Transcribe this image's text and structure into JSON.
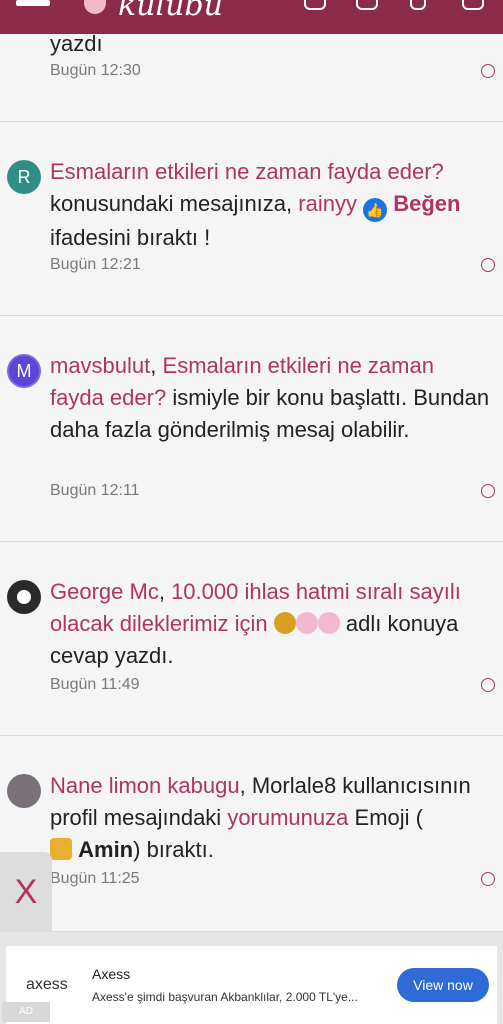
{
  "header": {
    "logo": "kulübü"
  },
  "items": [
    {
      "partial_text": "yazdı",
      "time": "Bugün 12:30"
    },
    {
      "avatar_letter": "R",
      "avatar_color": "#2f8f86",
      "line1_link": "Esmaların etkileri ne zaman fayda eder?",
      "line2_pre": "konusundaki mesajınıza,",
      "line2_user": "rainyy",
      "line2_like": "Beğen",
      "line3": "ifadesini bıraktı !",
      "time": "Bugün 12:21"
    },
    {
      "avatar_letter": "M",
      "avatar_color": "#5b46d6",
      "user": "mavsbulut",
      "link": "Esmaların etkileri ne zaman fayda eder?",
      "text_after": "ismiyle bir konu başlattı.",
      "text_more": "Bundan daha fazla gönderilmiş mesaj olabilir.",
      "time": "Bugün 12:11"
    },
    {
      "user": "George Mc",
      "link": "10.000 ihlas hatmi sıralı sayılı olacak dileklerimiz için",
      "text_after": "adlı konuya cevap yazdı.",
      "time": "Bugün 11:49"
    },
    {
      "user": "Nane limon kabugu",
      "text_mid": "Morlale8 kullanıcısının profil mesajındaki",
      "link": "yorumunuza",
      "text_after": "Emoji (",
      "emoji_label": "Amin",
      "text_end": ") bıraktı.",
      "time": "Bugün 11:25"
    }
  ],
  "close_label": "X",
  "ad": {
    "brand": "axess",
    "title": "Axess",
    "desc": "Axess'e şimdi başvuran Akbanklılar, 2.000 TL'ye...",
    "cta": "View now",
    "tag": "AD"
  }
}
